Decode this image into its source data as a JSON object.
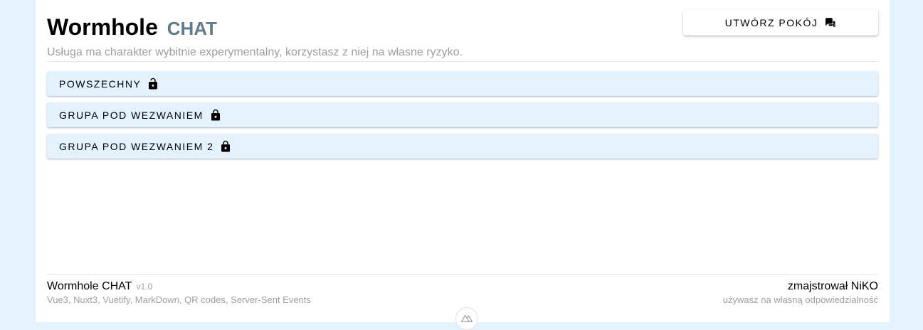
{
  "header": {
    "title": "Wormhole",
    "title_suffix": "CHAT",
    "subtitle": "Usługa ma charakter wybitnie experymentalny, korzystasz z niej na własne ryzyko."
  },
  "create_room": {
    "label": "Utwórz pokój",
    "icon": "chat-plus-icon"
  },
  "rooms": [
    {
      "label": "Powszechny",
      "icon": "lock-open-icon"
    },
    {
      "label": "Grupa pod wezwaniem",
      "icon": "lock-icon"
    },
    {
      "label": "Grupa pod wezwaniem 2",
      "icon": "lock-icon"
    }
  ],
  "footer": {
    "app_name": "Wormhole CHAT",
    "version": "v1.0",
    "stack": "Vue3, Nuxt3, Vuetify, MarkDown, QR codes, Server-Sent Events",
    "author": "zmajstrował NiKO",
    "disclaimer": "używasz na własną odpowiedzialność"
  },
  "colors": {
    "background": "#e3f2fd",
    "room_bg": "#e3f2fd",
    "accent": "#607d8b"
  }
}
